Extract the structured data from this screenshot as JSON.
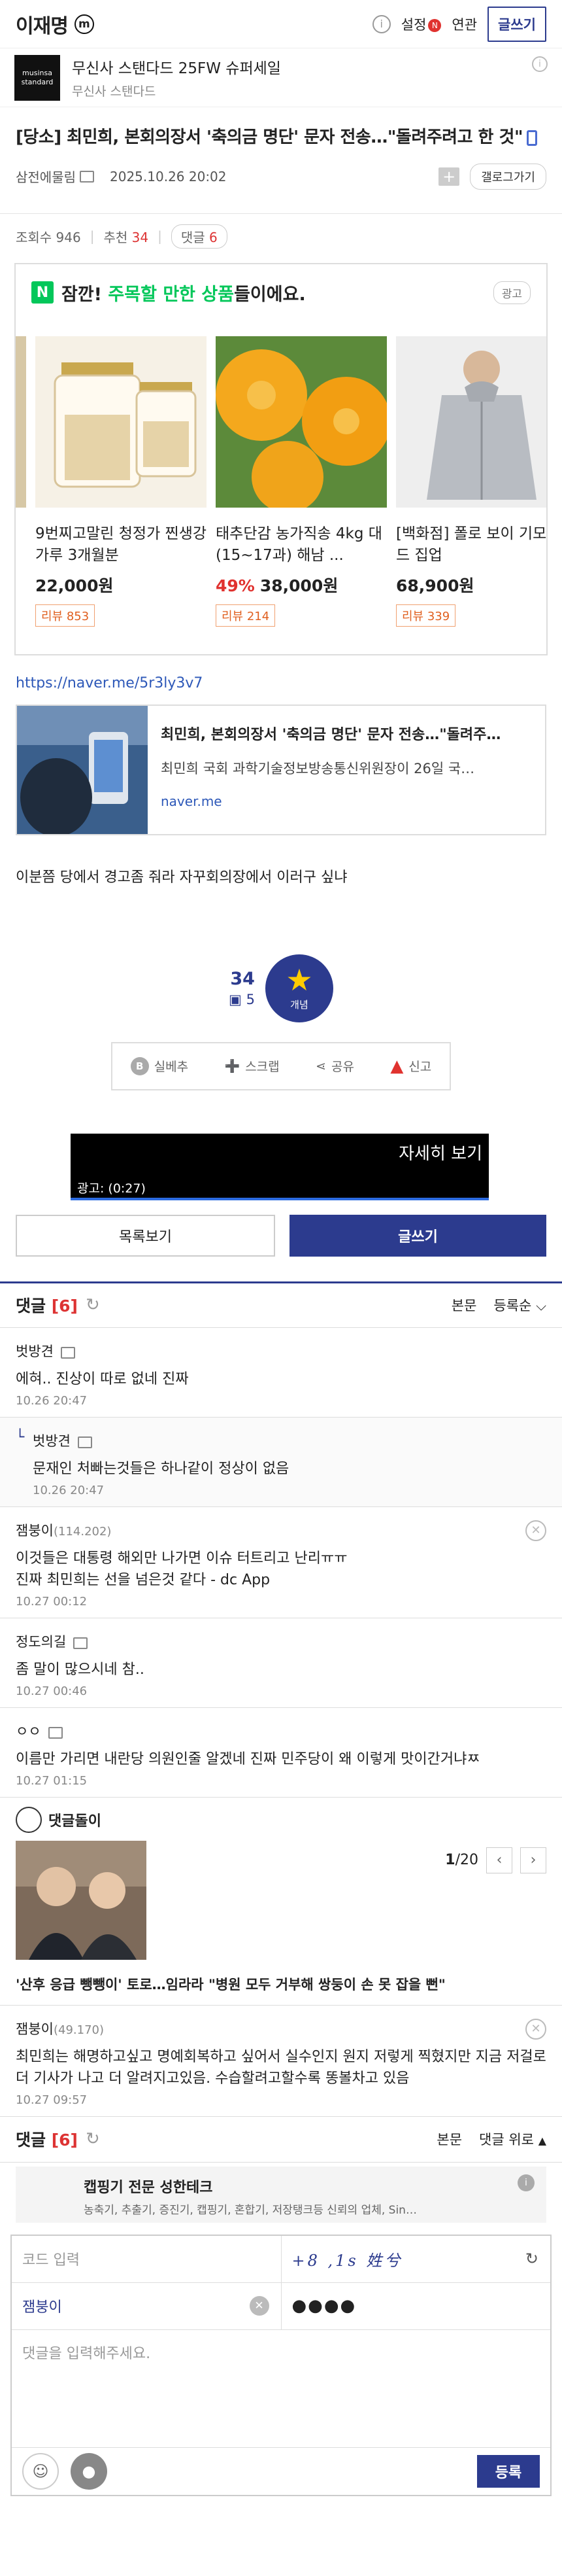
{
  "header": {
    "gallery_name": "이재명",
    "m_badge": "m",
    "info_icon": "i",
    "settings_label": "설정",
    "new_badge": "N",
    "related_label": "연관",
    "write_label": "글쓰기"
  },
  "top_ad": {
    "logo_line1": "musinsa",
    "logo_line2": "standard",
    "title": "무신사 스탠다드 25FW 슈퍼세일",
    "subtitle": "무신사 스탠다드",
    "info_icon": "i"
  },
  "post": {
    "title": "[당소] 최민희, 본회의장서 '축의금 명단' 문자 전송…\"돌려주려고 한 것\"",
    "author": "삼전에물림",
    "datetime": "2025.10.26 20:02",
    "gallery_button": "갤로그가기",
    "views_label": "조회수 946",
    "recommend_label": "추천",
    "recommend_value": "34",
    "comments_label": "댓글 6"
  },
  "shopping": {
    "badge": "N",
    "title_prefix": "잠깐!",
    "title_highlight": "주목할 만한 상품",
    "title_suffix": "들이에요.",
    "ad_label": "광고",
    "products": [
      {
        "name": "9번찌고말린 청정가 찐생강가루 3개월분",
        "discount": "",
        "price": "22,000원",
        "review": "리뷰 853"
      },
      {
        "name": "태추단감 농가직송 4kg 대(15~17과) 해남 ...",
        "discount": "49%",
        "price": "38,000원",
        "review": "리뷰 214"
      },
      {
        "name": "[백화점] 폴로 보이 기모 후드 집업",
        "discount": "",
        "price": "68,900원",
        "review": "리뷰 339"
      }
    ]
  },
  "link": {
    "url": "https://naver.me/5r3ly3v7",
    "card_title": "최민희, 본회의장서 '축의금 명단' 문자 전송…\"돌려주…",
    "card_desc": "최민희 국회 과학기술정보방송통신위원장이 26일 국…",
    "card_domain": "naver.me"
  },
  "body_text": "이분쯤 당에서 경고좀 줘라 자꾸회의장에서 이러구  싶냐",
  "recommend": {
    "up_count": "34",
    "fix_count": "5",
    "button_label": "개념"
  },
  "share_bar": {
    "silbe_label": "실베추",
    "scrap_label": "스크랩",
    "share_label": "공유",
    "report_label": "신고"
  },
  "video_ad": {
    "more_label": "자세히 보기",
    "time_label": "광고: (0:27)"
  },
  "buttons": {
    "list_label": "목록보기",
    "write_label": "글쓰기"
  },
  "comment_header": {
    "title": "댓글",
    "count": "[6]",
    "body_label": "본문",
    "sort_label": "등록순",
    "top_label": "댓글 위로"
  },
  "comments": [
    {
      "nick": "벗방견",
      "ip": "",
      "text": "에혀.. 진상이 따로 없네 진짜",
      "date": "10.26 20:47",
      "reply": false
    },
    {
      "nick": "벗방견",
      "ip": "",
      "text": "문재인 처빠는것들은 하나같이 정상이 없음",
      "date": "10.26 20:47",
      "reply": true
    },
    {
      "nick": "잼붕이",
      "ip": "(114.202)",
      "text": "이것들은 대통령 해외만 나가면 이슈 터트리고 난리ㅠㅠ\n진짜 최민희는 선을 넘은것 같다 - dc App",
      "date": "10.27 00:12",
      "reply": false
    },
    {
      "nick": "정도의길",
      "ip": "",
      "text": "좀 말이 많으시네 참..",
      "date": "10.27 00:46",
      "reply": false
    },
    {
      "nick": "ㅇㅇ",
      "ip": "",
      "text": "이름만 가리면 내란당 의원인줄 알겠네 진짜 민주당이 왜 이렇게 맛이간거냐ㅉ",
      "date": "10.27 01:15",
      "reply": false
    }
  ],
  "dolls": {
    "title": "댓글돌이",
    "page_current": "1",
    "page_total": "/20",
    "caption": "'산후 응급 뺑뺑이' 토로…임라라 \"병원 모두 거부해 쌍둥이 손 못 잡을 뻔\""
  },
  "last_comment": {
    "nick": "잼붕이",
    "ip": "(49.170)",
    "text": "최민희는 해명하고싶고 명예회복하고 싶어서 실수인지 원지 저렇게 찍혔지만 지금 저걸로 더 기사가 나고 더 알려지고있음. 수습할려고할수록 똥볼차고 있음",
    "date": "10.27 09:57"
  },
  "bottom_ad": {
    "title": "캡핑기 전문 성한테크",
    "desc": "농축기, 추출기, 증진기, 캡핑기, 혼합기, 저장탱크등 신뢰의 업체, Sin…",
    "info": "i"
  },
  "write_form": {
    "code_placeholder": "코드 입력",
    "captcha_text": "+8 ,1s 姓兮",
    "nickname_value": "잼붕이",
    "password_value": "●●●●",
    "comment_placeholder": "댓글을 입력해주세요.",
    "submit_label": "등록"
  }
}
